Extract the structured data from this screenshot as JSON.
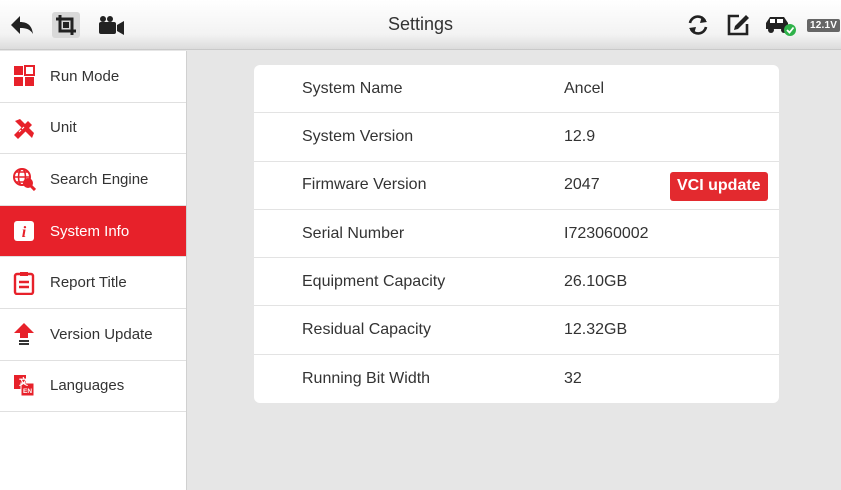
{
  "header": {
    "title": "Settings",
    "voltage": "12.1V",
    "icons": [
      "back-arrow-icon",
      "crop-icon",
      "video-camera-icon",
      "refresh-icon",
      "edit-icon",
      "car-connected-icon"
    ]
  },
  "sidebar": {
    "items": [
      {
        "label": "Run Mode",
        "icon": "run-mode-icon",
        "active": false
      },
      {
        "label": "Unit",
        "icon": "unit-ruler-icon",
        "active": false
      },
      {
        "label": "Search Engine",
        "icon": "globe-search-icon",
        "active": false
      },
      {
        "label": "System Info",
        "icon": "info-icon",
        "active": true
      },
      {
        "label": "Report Title",
        "icon": "clipboard-icon",
        "active": false
      },
      {
        "label": "Version Update",
        "icon": "upload-arrow-icon",
        "active": false
      },
      {
        "label": "Languages",
        "icon": "language-icon",
        "active": false
      }
    ]
  },
  "system_info": {
    "rows": [
      {
        "key": "System Name",
        "value": "Ancel"
      },
      {
        "key": "System Version",
        "value": "12.9"
      },
      {
        "key": "Firmware Version",
        "value": "2047"
      },
      {
        "key": "Serial Number",
        "value": "I723060002"
      },
      {
        "key": "Equipment Capacity",
        "value": "26.10GB"
      },
      {
        "key": "Residual Capacity",
        "value": "12.32GB"
      },
      {
        "key": "Running Bit Width",
        "value": "32"
      }
    ],
    "vci_button": "VCI update"
  },
  "colors": {
    "accent": "#e7212a",
    "background": "#e6e6e6",
    "voltage_badge": "#666666",
    "connected": "#2fb24a"
  }
}
